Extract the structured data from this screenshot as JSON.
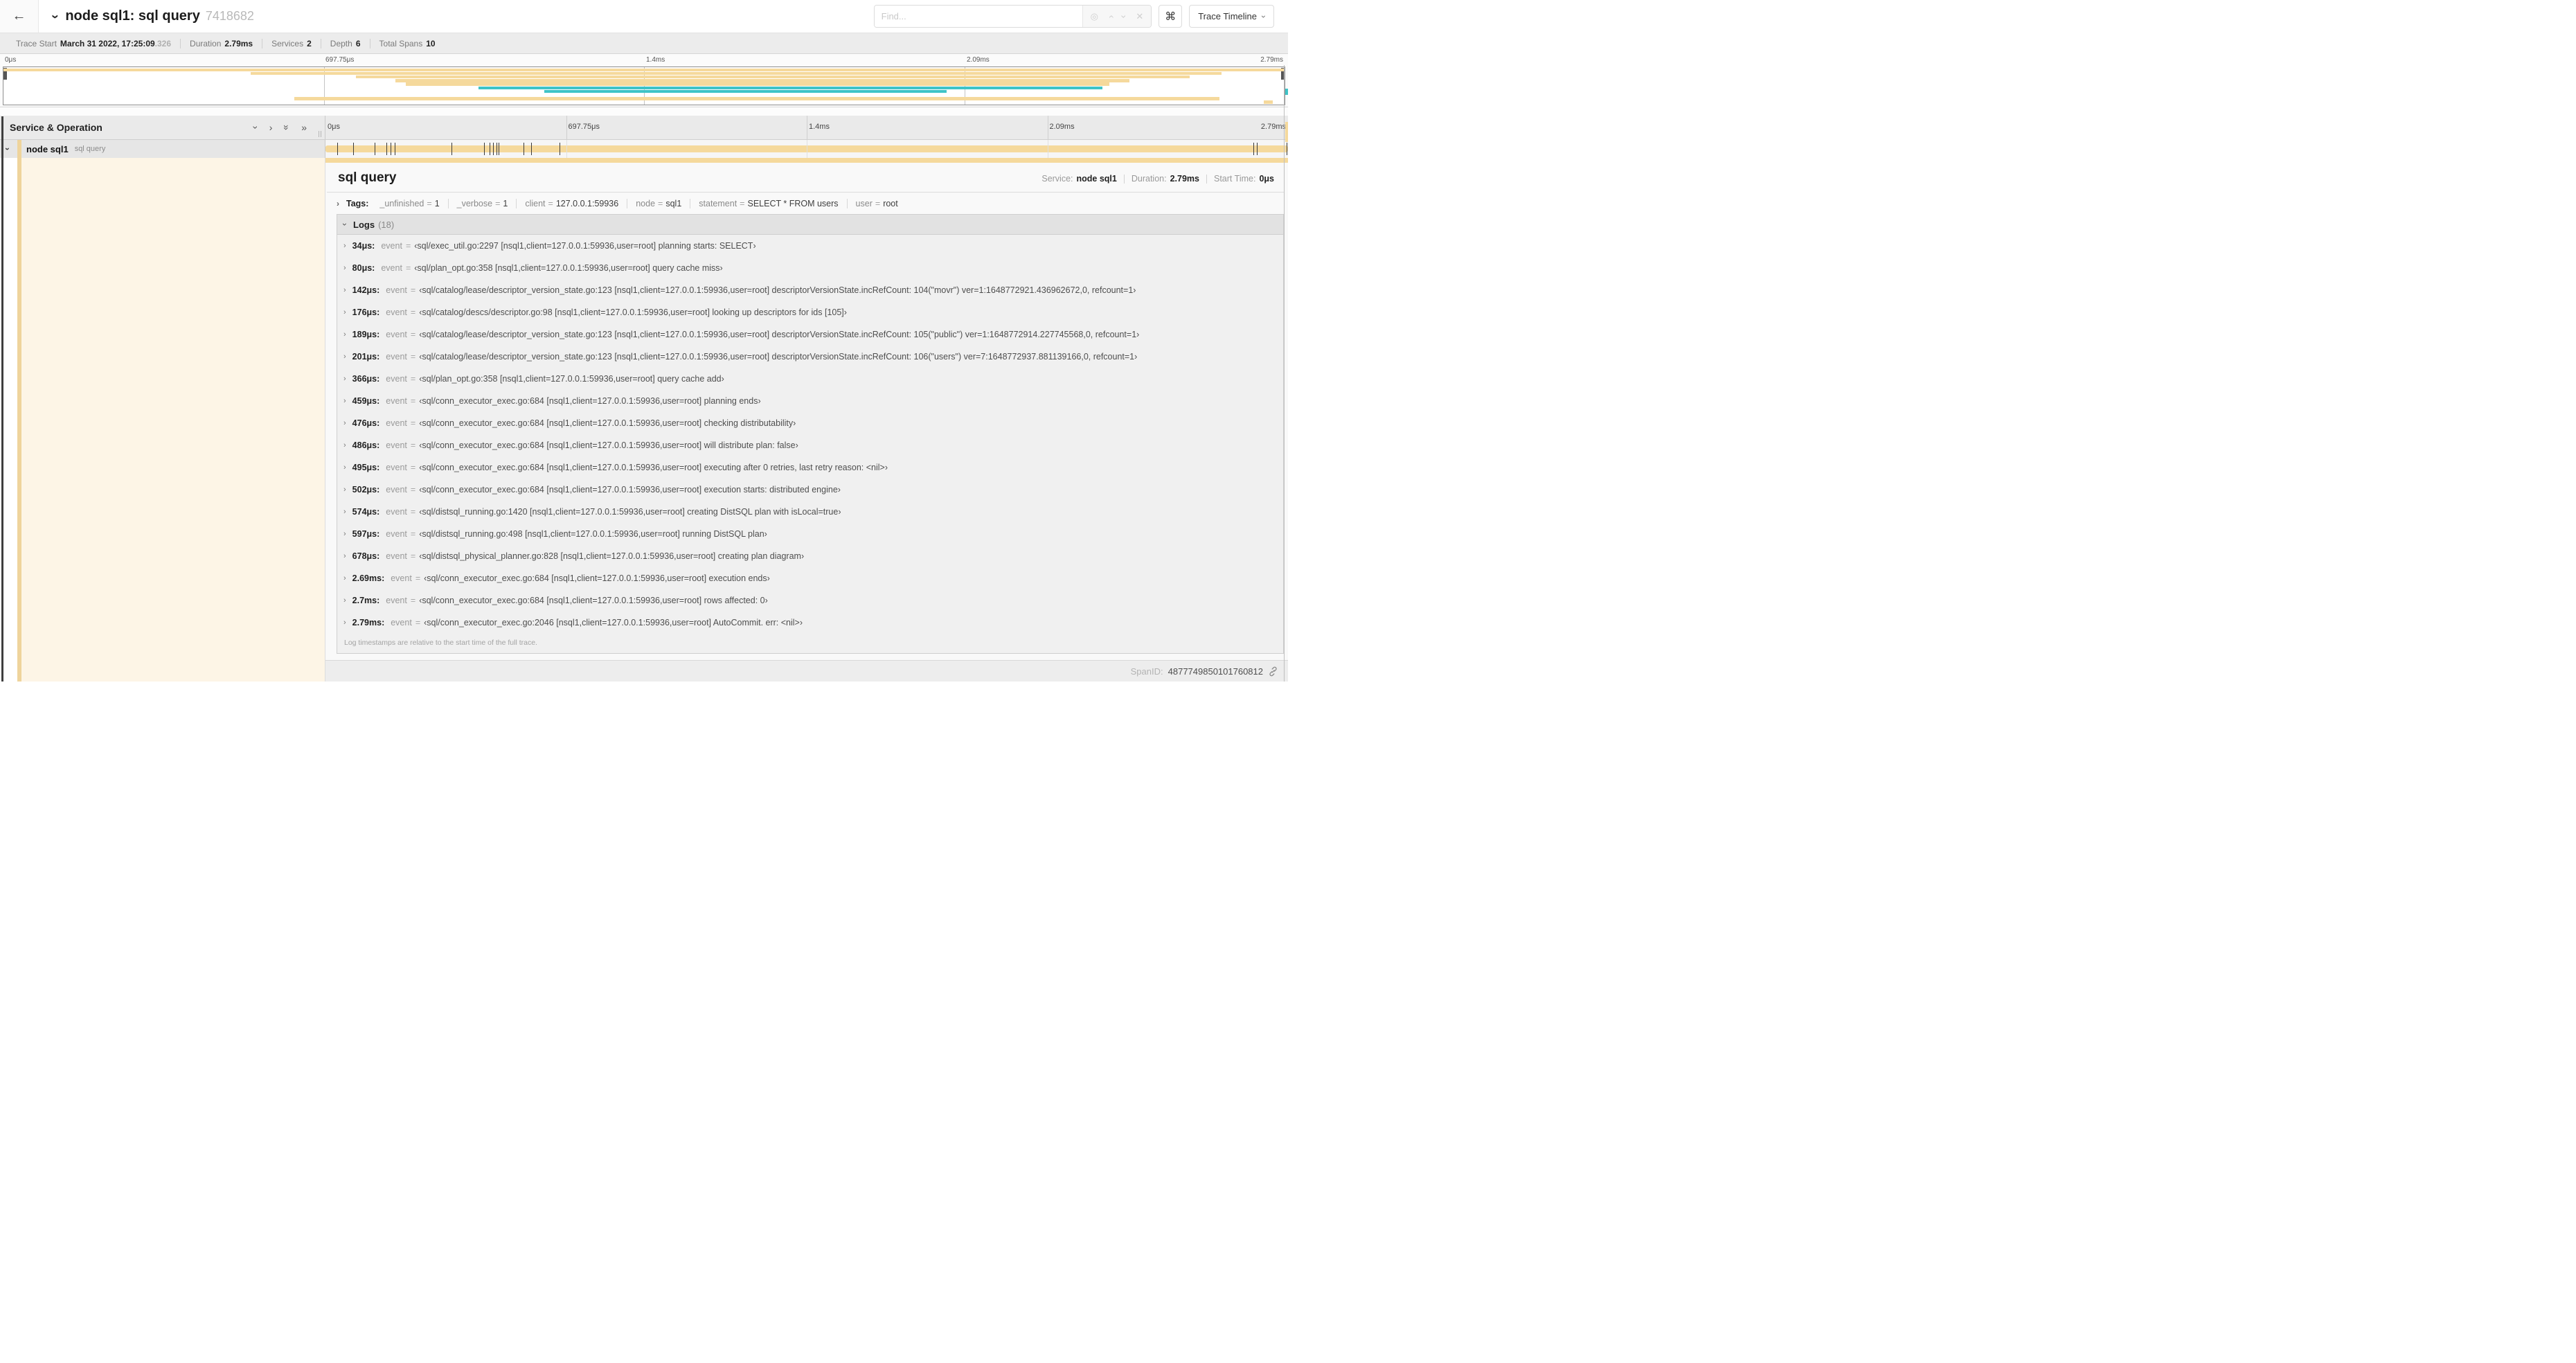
{
  "colors": {
    "tan": "#F5D99C",
    "teal": "#3EC3C7",
    "cream": "#FDF5E6",
    "stripe": "#EFD49C"
  },
  "header": {
    "back_icon": "←",
    "title": "node sql1: sql query",
    "trace_id_short": "7418682",
    "find_placeholder": "Find...",
    "command_icon": "⌘",
    "view_selector": "Trace Timeline"
  },
  "summary": {
    "trace_start_label": "Trace Start",
    "trace_start_value": "March 31 2022, 17:25:09",
    "trace_start_ms": ".326",
    "duration_label": "Duration",
    "duration_value": "2.79ms",
    "services_label": "Services",
    "services_value": "2",
    "depth_label": "Depth",
    "depth_value": "6",
    "total_spans_label": "Total Spans",
    "total_spans_value": "10"
  },
  "ruler": {
    "ticks": [
      "0μs",
      "697.75μs",
      "1.4ms",
      "2.09ms",
      "2.79ms"
    ]
  },
  "minimap": {
    "bars": [
      {
        "row": 0,
        "start": 0,
        "end": 1.0,
        "color": "tan"
      },
      {
        "row": 1,
        "start": 0.193,
        "end": 0.951,
        "color": "tan"
      },
      {
        "row": 2,
        "start": 0.275,
        "end": 0.926,
        "color": "tan"
      },
      {
        "row": 3,
        "start": 0.306,
        "end": 0.879,
        "color": "tan"
      },
      {
        "row": 4,
        "start": 0.314,
        "end": 0.863,
        "color": "tan"
      },
      {
        "row": 5,
        "start": 0.371,
        "end": 0.858,
        "color": "teal"
      },
      {
        "row": 6,
        "start": 0.422,
        "end": 0.736,
        "color": "teal"
      },
      {
        "row": 8,
        "start": 0.227,
        "end": 0.949,
        "color": "tan"
      },
      {
        "row": 9,
        "start": 0.984,
        "end": 0.991,
        "color": "tan"
      }
    ]
  },
  "grid": {
    "left_header": "Service & Operation",
    "collapse_icons": [
      "collapse-one-icon",
      "expand-one-icon",
      "collapse-all-icon",
      "expand-all-icon"
    ]
  },
  "span_row": {
    "service": "node sql1",
    "operation": "sql query",
    "duration_us": 2790,
    "tick_times_us": [
      34,
      80,
      142,
      176,
      189,
      201,
      366,
      459,
      476,
      486,
      495,
      502,
      574,
      597,
      678,
      2690,
      2700,
      2790
    ]
  },
  "detail": {
    "operation": "sql query",
    "service_label": "Service:",
    "service": "node sql1",
    "duration_label": "Duration:",
    "duration": "2.79ms",
    "start_time_label": "Start Time:",
    "start_time": "0μs",
    "tags": {
      "label": "Tags:",
      "items": [
        {
          "key": "_unfinished",
          "value": "1"
        },
        {
          "key": "_verbose",
          "value": "1"
        },
        {
          "key": "client",
          "value": "127.0.0.1:59936"
        },
        {
          "key": "node",
          "value": "sql1"
        },
        {
          "key": "statement",
          "value": "SELECT * FROM users"
        },
        {
          "key": "user",
          "value": "root"
        }
      ]
    },
    "logs": {
      "label": "Logs",
      "count": "(18)",
      "entries": [
        {
          "time": "34μs:",
          "key": "event",
          "value": "‹sql/exec_util.go:2297 [nsql1,client=127.0.0.1:59936,user=root] planning starts: SELECT›"
        },
        {
          "time": "80μs:",
          "key": "event",
          "value": "‹sql/plan_opt.go:358 [nsql1,client=127.0.0.1:59936,user=root] query cache miss›"
        },
        {
          "time": "142μs:",
          "key": "event",
          "value": "‹sql/catalog/lease/descriptor_version_state.go:123 [nsql1,client=127.0.0.1:59936,user=root] descriptorVersionState.incRefCount: 104(\"movr\") ver=1:1648772921.436962672,0, refcount=1›"
        },
        {
          "time": "176μs:",
          "key": "event",
          "value": "‹sql/catalog/descs/descriptor.go:98 [nsql1,client=127.0.0.1:59936,user=root] looking up descriptors for ids [105]›"
        },
        {
          "time": "189μs:",
          "key": "event",
          "value": "‹sql/catalog/lease/descriptor_version_state.go:123 [nsql1,client=127.0.0.1:59936,user=root] descriptorVersionState.incRefCount: 105(\"public\") ver=1:1648772914.227745568,0, refcount=1›"
        },
        {
          "time": "201μs:",
          "key": "event",
          "value": "‹sql/catalog/lease/descriptor_version_state.go:123 [nsql1,client=127.0.0.1:59936,user=root] descriptorVersionState.incRefCount: 106(\"users\") ver=7:1648772937.881139166,0, refcount=1›"
        },
        {
          "time": "366μs:",
          "key": "event",
          "value": "‹sql/plan_opt.go:358 [nsql1,client=127.0.0.1:59936,user=root] query cache add›"
        },
        {
          "time": "459μs:",
          "key": "event",
          "value": "‹sql/conn_executor_exec.go:684 [nsql1,client=127.0.0.1:59936,user=root] planning ends›"
        },
        {
          "time": "476μs:",
          "key": "event",
          "value": "‹sql/conn_executor_exec.go:684 [nsql1,client=127.0.0.1:59936,user=root] checking distributability›"
        },
        {
          "time": "486μs:",
          "key": "event",
          "value": "‹sql/conn_executor_exec.go:684 [nsql1,client=127.0.0.1:59936,user=root] will distribute plan: false›"
        },
        {
          "time": "495μs:",
          "key": "event",
          "value": "‹sql/conn_executor_exec.go:684 [nsql1,client=127.0.0.1:59936,user=root] executing after 0 retries, last retry reason: <nil>›"
        },
        {
          "time": "502μs:",
          "key": "event",
          "value": "‹sql/conn_executor_exec.go:684 [nsql1,client=127.0.0.1:59936,user=root] execution starts: distributed engine›"
        },
        {
          "time": "574μs:",
          "key": "event",
          "value": "‹sql/distsql_running.go:1420 [nsql1,client=127.0.0.1:59936,user=root] creating DistSQL plan with isLocal=true›"
        },
        {
          "time": "597μs:",
          "key": "event",
          "value": "‹sql/distsql_running.go:498 [nsql1,client=127.0.0.1:59936,user=root] running DistSQL plan›"
        },
        {
          "time": "678μs:",
          "key": "event",
          "value": "‹sql/distsql_physical_planner.go:828 [nsql1,client=127.0.0.1:59936,user=root] creating plan diagram›"
        },
        {
          "time": "2.69ms:",
          "key": "event",
          "value": "‹sql/conn_executor_exec.go:684 [nsql1,client=127.0.0.1:59936,user=root] execution ends›"
        },
        {
          "time": "2.7ms:",
          "key": "event",
          "value": "‹sql/conn_executor_exec.go:684 [nsql1,client=127.0.0.1:59936,user=root] rows affected: 0›"
        },
        {
          "time": "2.79ms:",
          "key": "event",
          "value": "‹sql/conn_executor_exec.go:2046 [nsql1,client=127.0.0.1:59936,user=root] AutoCommit. err: <nil>›"
        }
      ],
      "footnote": "Log timestamps are relative to the start time of the full trace."
    },
    "span_id_label": "SpanID:",
    "span_id": "4877749850101760812"
  }
}
